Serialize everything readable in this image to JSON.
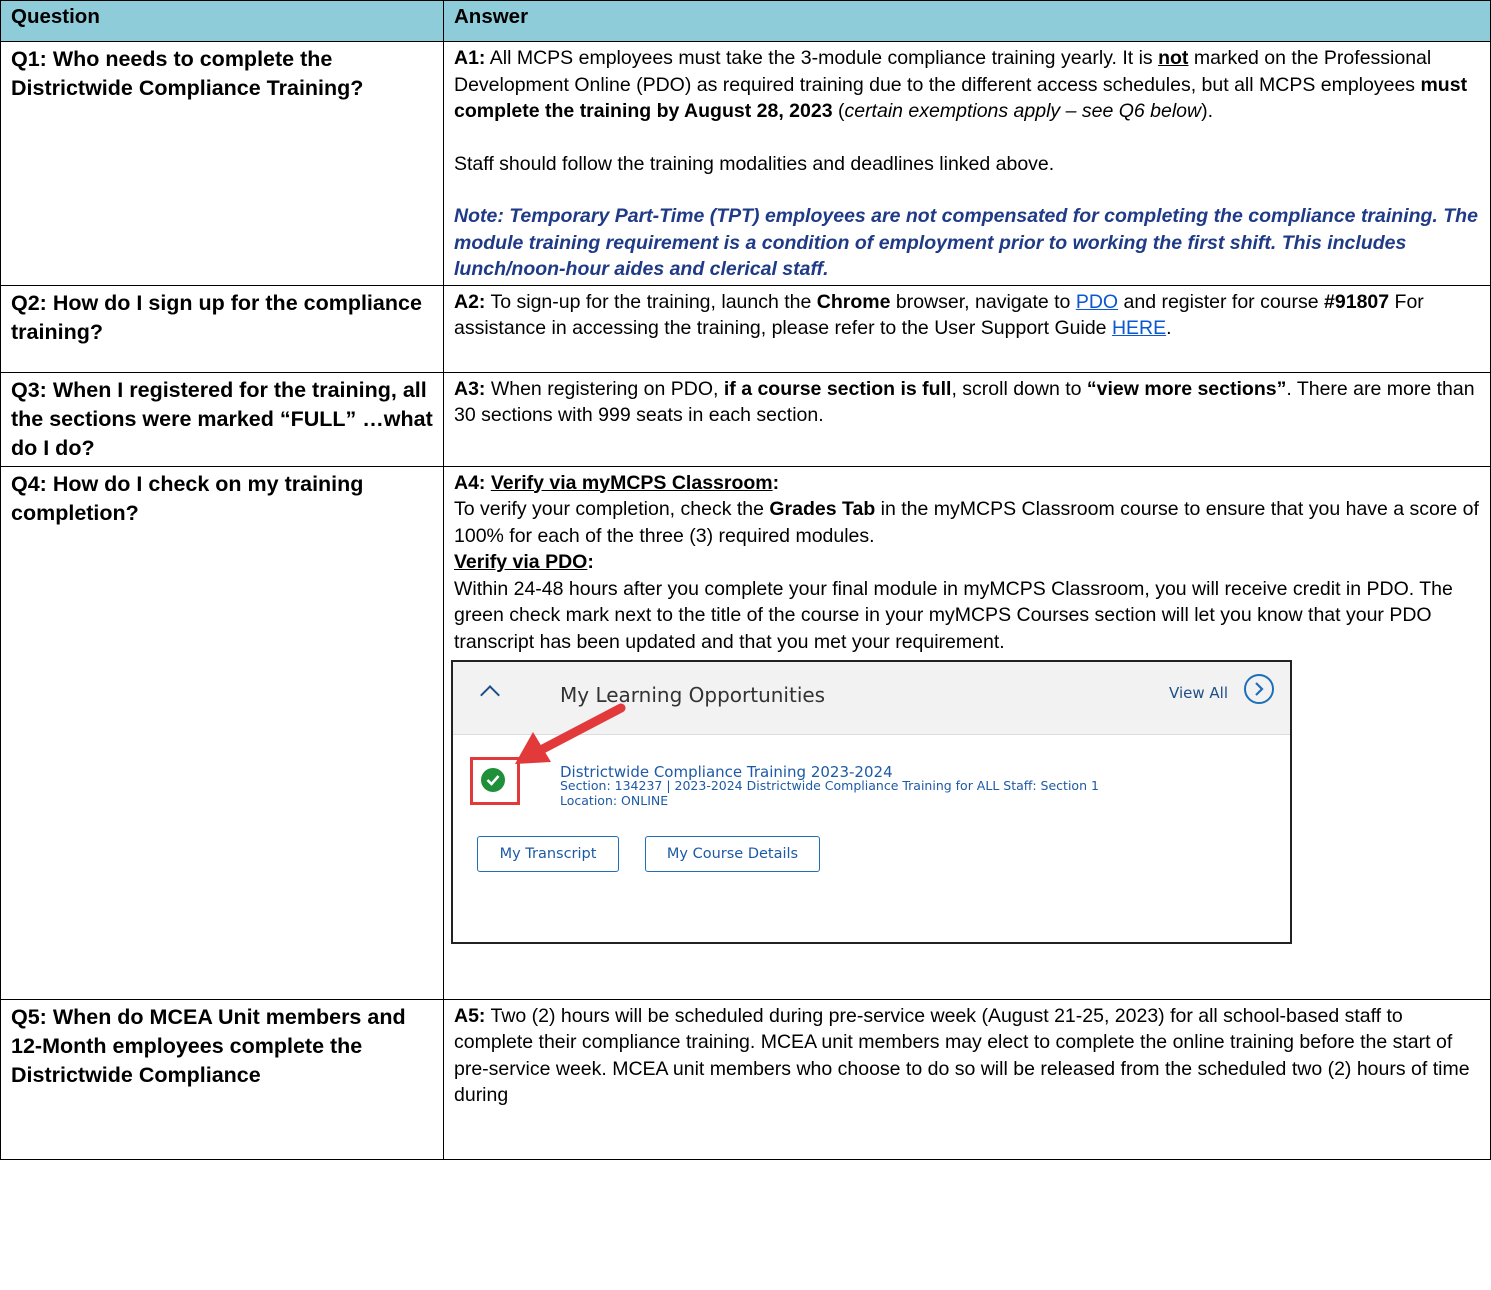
{
  "header": {
    "question": "Question",
    "answer": "Answer"
  },
  "rows": [
    {
      "q": "Q1: Who needs to complete the Districtwide Compliance Training?",
      "a_label": "A1:",
      "a_p1_1": " All MCPS employees must take the 3-module compliance training yearly. It is ",
      "a_p1_not": "not",
      "a_p1_2": " marked on the Professional Development Online (PDO) as required training due to the different access schedules, but all MCPS employees ",
      "a_p1_bold": "must complete the training by August 28, 2023",
      "a_p1_3": " (",
      "a_p1_italic": "certain exemptions apply – see Q6 below",
      "a_p1_4": ").",
      "a_p2": "Staff should follow the training modalities and deadlines linked above.",
      "a_note": "Note: Temporary Part-Time (TPT) employees are not compensated for completing the compliance training. The module training requirement is a condition of employment prior to working the first shift. This includes lunch/noon-hour aides and clerical staff."
    },
    {
      "q": "Q2: How do I sign up for the compliance training?",
      "a_label": "A2:",
      "a_1": " To sign-up for the training, launch the ",
      "a_chrome": "Chrome",
      "a_2": " browser, navigate to ",
      "a_pdo_link": "PDO",
      "a_3": " and register for course ",
      "a_course": "#91807",
      "a_4": " For assistance in accessing the training, please refer to the User Support Guide ",
      "a_here_link": "HERE",
      "a_5": "."
    },
    {
      "q": "Q3: When I registered for the training, all the sections were marked “FULL” …what do I do?",
      "a_label": "A3:",
      "a_1": " When registering on PDO, ",
      "a_bold1": "if a course section is full",
      "a_2": ", scroll down to ",
      "a_bold2": "“view more sections”",
      "a_3": ". There are more than 30 sections with 999 seats in each section."
    },
    {
      "q": "Q4: How do I check on my training completion?",
      "a_label": "A4: ",
      "a_h1": "Verify via myMCPS Classroom",
      "a_h1_colon": ":",
      "a_p1_1": "To verify your completion, check the ",
      "a_p1_bold": "Grades Tab",
      "a_p1_2": " in the myMCPS Classroom course to ensure that you have a score of 100% for each of the three (3) required modules.",
      "a_h2": "Verify via PDO",
      "a_h2_colon": ":",
      "a_p2": "Within 24-48 hours after you complete your final module in myMCPS Classroom, you will receive credit in PDO.  The green check mark next to the title of the course in your myMCPS Courses section will let you know that your PDO transcript has been updated and that you met your requirement.",
      "shot": {
        "panel_title": "My Learning Opportunities",
        "view_all": "View All",
        "course_title": "Districtwide Compliance Training 2023-2024",
        "course_section": "Section: 134237 | 2023-2024 Districtwide Compliance Training for ALL Staff: Section 1",
        "course_location": "Location: ONLINE",
        "btn_transcript": "My Transcript",
        "btn_details": "My Course Details"
      }
    },
    {
      "q": "Q5: When do MCEA Unit members and 12-Month employees complete the Districtwide Compliance",
      "a_label": "A5:",
      "a_text": " Two (2) hours will be scheduled during pre-service week (August 21-25, 2023) for all school-based staff to complete their compliance training. MCEA unit members may elect to complete the online training before the start of pre-service week.  MCEA unit members who choose to do so will be released from the scheduled two (2) hours of time during"
    }
  ]
}
